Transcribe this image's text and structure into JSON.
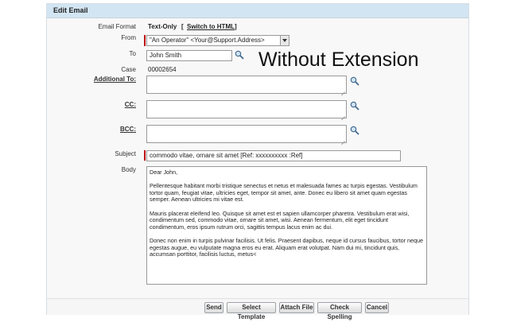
{
  "panel": {
    "title": "Edit Email"
  },
  "form": {
    "email_format": {
      "label": "Email Format",
      "value": "Text-Only",
      "switch_link": "Switch to HTML",
      "open_bracket": "[",
      "close_bracket": "]"
    },
    "from": {
      "label": "From",
      "value": "\"An Operator\" <Your@Support.Address>"
    },
    "to": {
      "label": "To",
      "value": "John Smith"
    },
    "case": {
      "label": "Case",
      "value": "00002654"
    },
    "additional_to": {
      "label": "Additional To:",
      "value": ""
    },
    "cc": {
      "label": "CC:",
      "value": ""
    },
    "bcc": {
      "label": "BCC:",
      "value": ""
    },
    "subject": {
      "label": "Subject",
      "value": "commodo vitae, ornare sit amet [Ref: xxxxxxxxxx :Ref]"
    },
    "body": {
      "label": "Body",
      "value": "Dear John,\n\nPellentesque habitant morbi tristique senectus et netus et malesuada fames ac turpis egestas. Vestibulum tortor quam, feugiat vitae, ultricies eget, tempor sit amet, ante. Donec eu libero sit amet quam egestas semper. Aenean ultricies mi vitae est.\n\nMauris placerat eleifend leo. Quisque sit amet est et sapien ullamcorper pharetra. Vestibulum erat wisi, condimentum sed, commodo vitae, ornare sit amet, wisi. Aenean fermentum, elit eget tincidunt condimentum, eros ipsum rutrum orci, sagittis tempus lacus enim ac dui.\n\nDonec non enim in turpis pulvinar facilisis. Ut felis. Praesent dapibus, neque id cursus faucibus, tortor neque egestas augue, eu vulputate magna eros eu erat. Aliquam erat volutpat. Nam dui mi, tincidunt quis, accumsan porttitor, facilisis luctus, metus<"
    }
  },
  "overlay_text": "Without Extension",
  "buttons": {
    "send": "Send",
    "select_template": "Select Template",
    "attach_file": "Attach File",
    "check_spelling": "Check Spelling",
    "cancel": "Cancel"
  },
  "colors": {
    "header_bg": "#d2e5f2",
    "required": "#c00000"
  }
}
